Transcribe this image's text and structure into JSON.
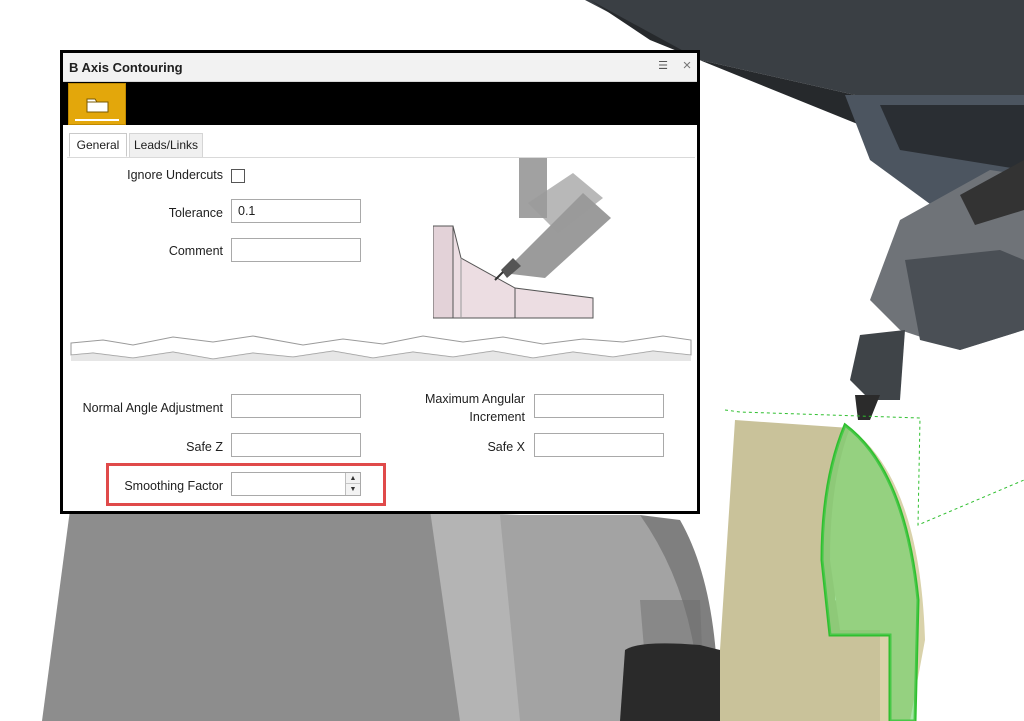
{
  "dialog": {
    "title": "B Axis Contouring",
    "toolbar": {
      "active_tool_icon": "folder-icon",
      "accent_color": "#e3a70b"
    },
    "tabs": [
      {
        "label": "General",
        "active": true
      },
      {
        "label": "Leads/Links",
        "active": false
      }
    ],
    "general": {
      "ignore_undercuts": {
        "label": "Ignore Undercuts",
        "checked": false
      },
      "tolerance": {
        "label": "Tolerance",
        "value": "0.1"
      },
      "comment": {
        "label": "Comment",
        "value": ""
      },
      "normal_angle_adjustment": {
        "label": "Normal Angle Adjustment",
        "value": ""
      },
      "maximum_angular_increment": {
        "label_line1": "Maximum Angular",
        "label_line2": "Increment",
        "value": ""
      },
      "safe_z": {
        "label": "Safe Z",
        "value": ""
      },
      "safe_x": {
        "label": "Safe X",
        "value": ""
      },
      "smoothing_factor": {
        "label": "Smoothing Factor",
        "value": ""
      }
    },
    "highlight_color": "#e04a4a"
  },
  "scene": {
    "toolpath_color": "#2fbf2f",
    "stock_color": "#c9c29a"
  }
}
